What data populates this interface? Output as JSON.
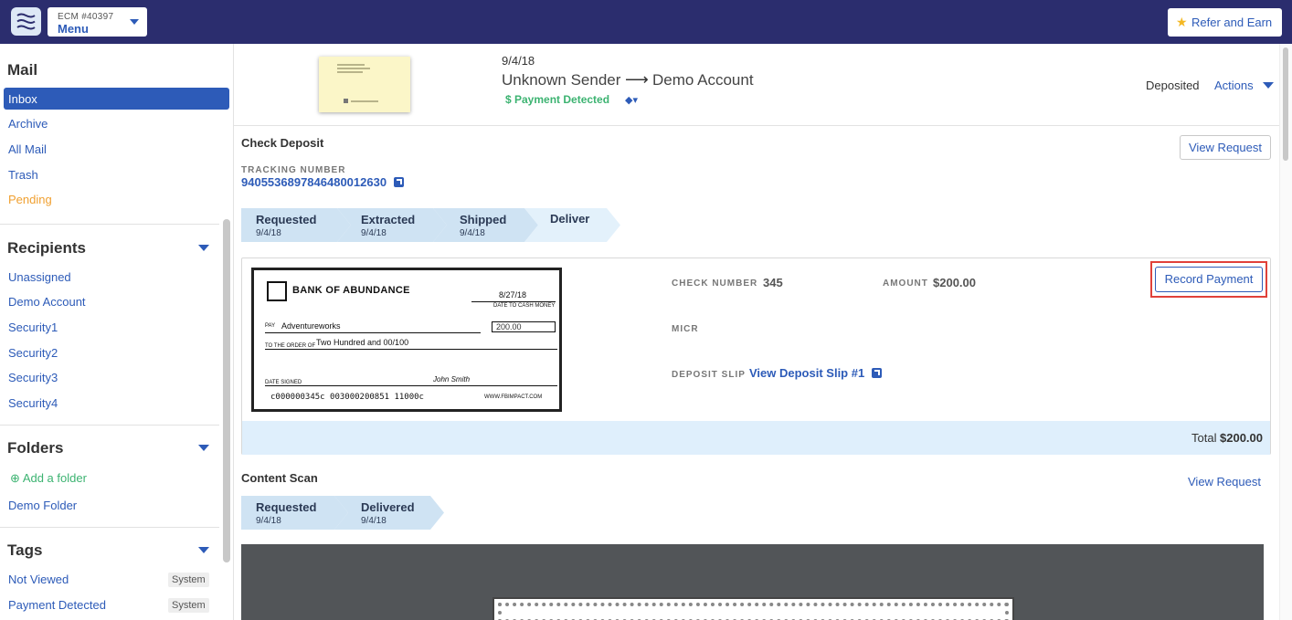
{
  "topbar": {
    "account_id": "ECM #40397",
    "menu_label": "Menu",
    "refer_label": "Refer and Earn"
  },
  "sidebar": {
    "mail_heading": "Mail",
    "mail_items": [
      "Inbox",
      "Archive",
      "All Mail",
      "Trash",
      "Pending"
    ],
    "active_item": "Inbox",
    "recipients_heading": "Recipients",
    "recipients": [
      "Unassigned",
      "Demo Account",
      "Security1",
      "Security2",
      "Security3",
      "Security4"
    ],
    "folders_heading": "Folders",
    "add_folder_label": "Add a folder",
    "folders": [
      "Demo Folder"
    ],
    "tags_heading": "Tags",
    "tags": [
      {
        "label": "Not Viewed",
        "badge": "System"
      },
      {
        "label": "Payment Detected",
        "badge": "System"
      }
    ]
  },
  "mail_header": {
    "date": "9/4/18",
    "sender": "Unknown Sender",
    "recipient": "Demo Account",
    "payment_flag": "$ Payment Detected",
    "status": "Deposited",
    "actions_label": "Actions"
  },
  "check_deposit": {
    "title": "Check Deposit",
    "view_request_label": "View Request",
    "tracking_label": "TRACKING NUMBER",
    "tracking_number": "9405536897846480012630",
    "steps": [
      {
        "name": "Requested",
        "date": "9/4/18"
      },
      {
        "name": "Extracted",
        "date": "9/4/18"
      },
      {
        "name": "Shipped",
        "date": "9/4/18"
      },
      {
        "name": "Deliver",
        "date": ""
      }
    ],
    "check": {
      "bank_name": "BANK OF ABUNDANCE",
      "date": "8/27/18",
      "date_label": "DATE TO CASH MONEY",
      "pay_label": "PAY",
      "payee": "Adventureworks",
      "amount_box": "200.00",
      "order_label": "TO THE ORDER OF",
      "amount_words": "Two Hundred and 00/100",
      "signed_label": "DATE SIGNED",
      "signature": "John Smith",
      "micr_line": "c000000345c  003000200851  11000c",
      "website": "WWW.FBIMPACT.COM"
    },
    "check_number_label": "CHECK NUMBER",
    "check_number": "345",
    "amount_label": "AMOUNT",
    "amount": "$200.00",
    "micr_label": "MICR",
    "deposit_slip_label": "DEPOSIT SLIP",
    "deposit_slip_link": "View Deposit Slip #1",
    "record_payment_label": "Record Payment",
    "total_label": "Total",
    "total_value": "$200.00"
  },
  "content_scan": {
    "title": "Content Scan",
    "view_request_label": "View Request",
    "steps": [
      {
        "name": "Requested",
        "date": "9/4/18"
      },
      {
        "name": "Delivered",
        "date": "9/4/18"
      }
    ]
  },
  "colors": {
    "topbar": "#2b2d6e",
    "accent": "#2d5bb8",
    "success": "#3cb371",
    "pending": "#f0a030",
    "highlight": "#e0413a"
  }
}
